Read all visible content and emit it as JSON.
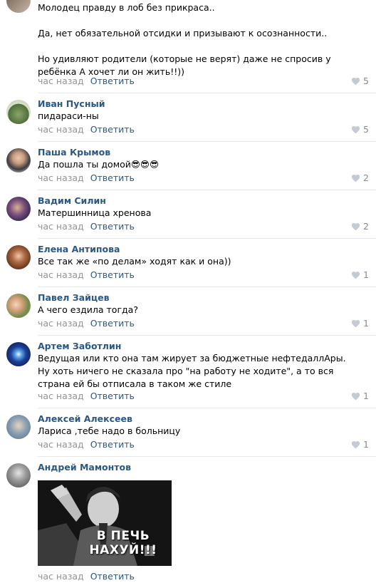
{
  "reply_label": "Ответить",
  "comments": [
    {
      "author": "",
      "text": "Молодец правду в лоб без прикраса..\n\nДа, нет обязательной отсидки и призывают к осознанности..\n\nНо удивляют родители (которые не верят) даже не спросив у ребёнка А хочет ли он жить!!))",
      "time": "час назад",
      "likes": "5"
    },
    {
      "author": "Иван Пусный",
      "text": "пидараси-ны",
      "time": "час назад",
      "likes": "5"
    },
    {
      "author": "Паша Крымов",
      "text": "Да пошла ты домой😎😎😎",
      "time": "час назад",
      "likes": "2"
    },
    {
      "author": "Вадим Силин",
      "text": "Матершинница хренова",
      "time": "час назад",
      "likes": "2"
    },
    {
      "author": "Елена Антипова",
      "text": "Все так же «по делам» ходят как и она))",
      "time": "час назад",
      "likes": "1"
    },
    {
      "author": "Павел Зайцев",
      "text": "А чего ездила тогда?",
      "time": "час назад",
      "likes": "1"
    },
    {
      "author": "Артем Заботлин",
      "text": "Ведущая или кто она там жирует за бюджетные нефтедаллАры. Ну хоть ничего не сказала про \"на работу не ходите\", а то вся страна ей бы отписала в таком же стиле",
      "time": "час назад",
      "likes": "1"
    },
    {
      "author": "Алексей Алексеев",
      "text": "Лариса ,тебе надо в больницу",
      "time": "час назад",
      "likes": "1"
    },
    {
      "author": "Андрей Мамонтов",
      "text": "",
      "time": "час назад",
      "likes": ""
    }
  ],
  "meme": {
    "caption": "В ПЕЧЬ НАХУЙ!!!"
  },
  "colors": {
    "author": "#2a5885",
    "meta": "#939393",
    "separator": "#e7e8ec"
  }
}
